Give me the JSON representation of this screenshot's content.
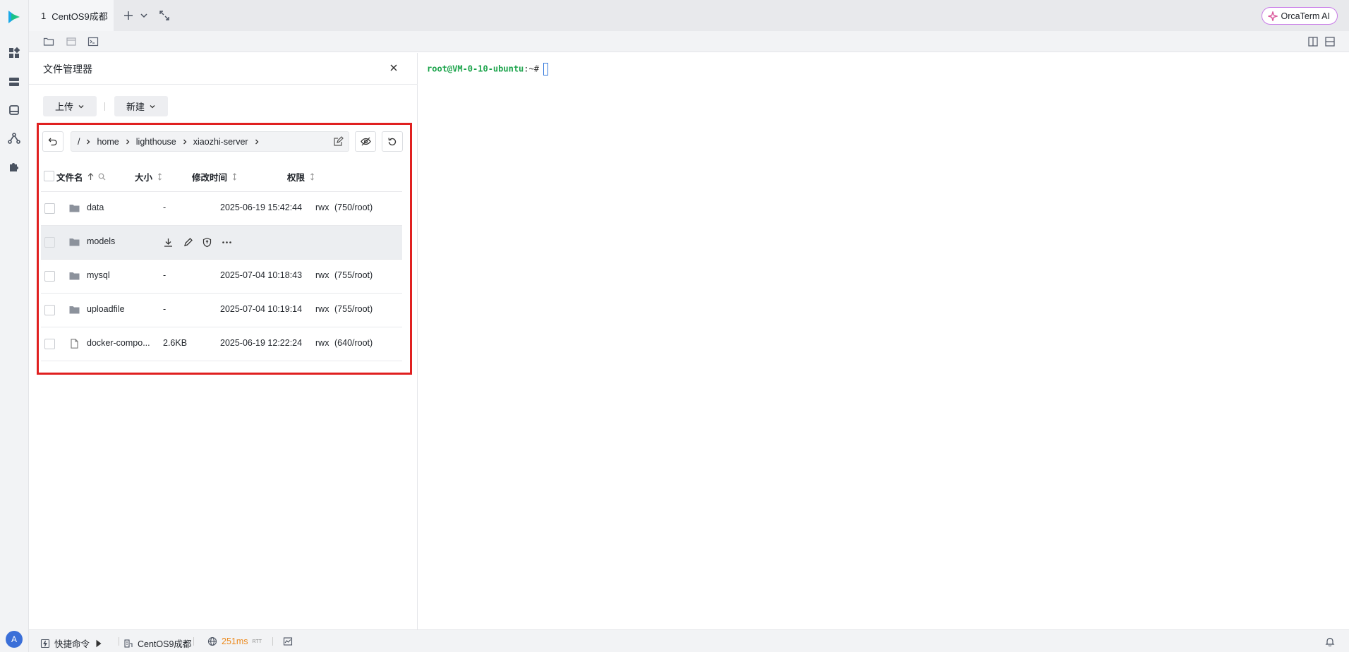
{
  "session_tab": {
    "number": "1",
    "label": "CentOS9成都"
  },
  "orca_ai": {
    "label": "OrcaTerm AI"
  },
  "file_manager": {
    "title": "文件管理器",
    "upload_label": "上传",
    "new_label": "新建",
    "path": [
      "/",
      "home",
      "lighthouse",
      "xiaozhi-server"
    ],
    "columns": {
      "name": "文件名",
      "size": "大小",
      "modified": "修改时间",
      "perm": "权限"
    },
    "rows": [
      {
        "name": "data",
        "type": "folder",
        "size": "-",
        "modified": "2025-06-19 15:42:44",
        "perm": "rwx",
        "owner": "(750/root)"
      },
      {
        "name": "models",
        "type": "folder",
        "size": "",
        "modified": "",
        "perm": "",
        "owner": ""
      },
      {
        "name": "mysql",
        "type": "folder",
        "size": "-",
        "modified": "2025-07-04 10:18:43",
        "perm": "rwx",
        "owner": "(755/root)"
      },
      {
        "name": "uploadfile",
        "type": "folder",
        "size": "-",
        "modified": "2025-07-04 10:19:14",
        "perm": "rwx",
        "owner": "(755/root)"
      },
      {
        "name": "docker-compo...",
        "type": "file",
        "size": "2.6KB",
        "modified": "2025-06-19 12:22:24",
        "perm": "rwx",
        "owner": "(640/root)"
      }
    ]
  },
  "terminal": {
    "user_host": "root@VM-0-10-ubuntu",
    "suffix": ":~#"
  },
  "status": {
    "quick_command": "快捷命令",
    "server": "CentOS9成都",
    "latency": "251ms",
    "rtt": "RTT"
  },
  "colors": {
    "highlight": "#e02020",
    "prompt": "#1aa34a",
    "latency": "#ec8a1e"
  }
}
